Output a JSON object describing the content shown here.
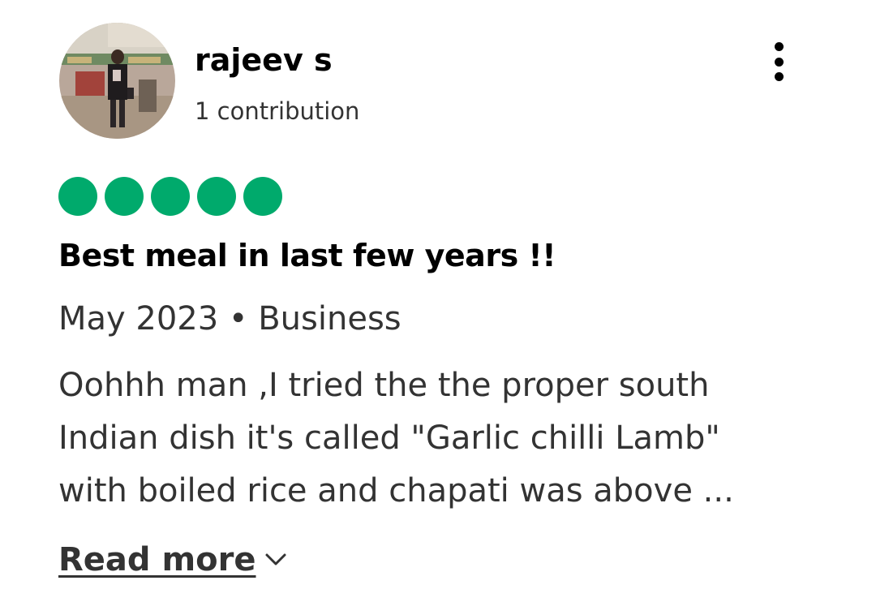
{
  "review": {
    "user": {
      "name": "rajeev s",
      "contributions": "1 contribution",
      "avatar_icon": "user-photo-avatar"
    },
    "menu_icon": "more-vertical-icon",
    "rating": {
      "value": 5,
      "max": 5,
      "color": "#00aa6c"
    },
    "title": "Best meal in last few years !!",
    "visit": "May 2023 • Business",
    "body_lines": [
      "Oohhh man ,I tried the the proper south",
      "Indian dish it's called \"Garlic chilli Lamb\"",
      "with boiled rice and chapati was above ..."
    ],
    "read_more": {
      "label": "Read more",
      "icon": "chevron-down-icon"
    }
  }
}
